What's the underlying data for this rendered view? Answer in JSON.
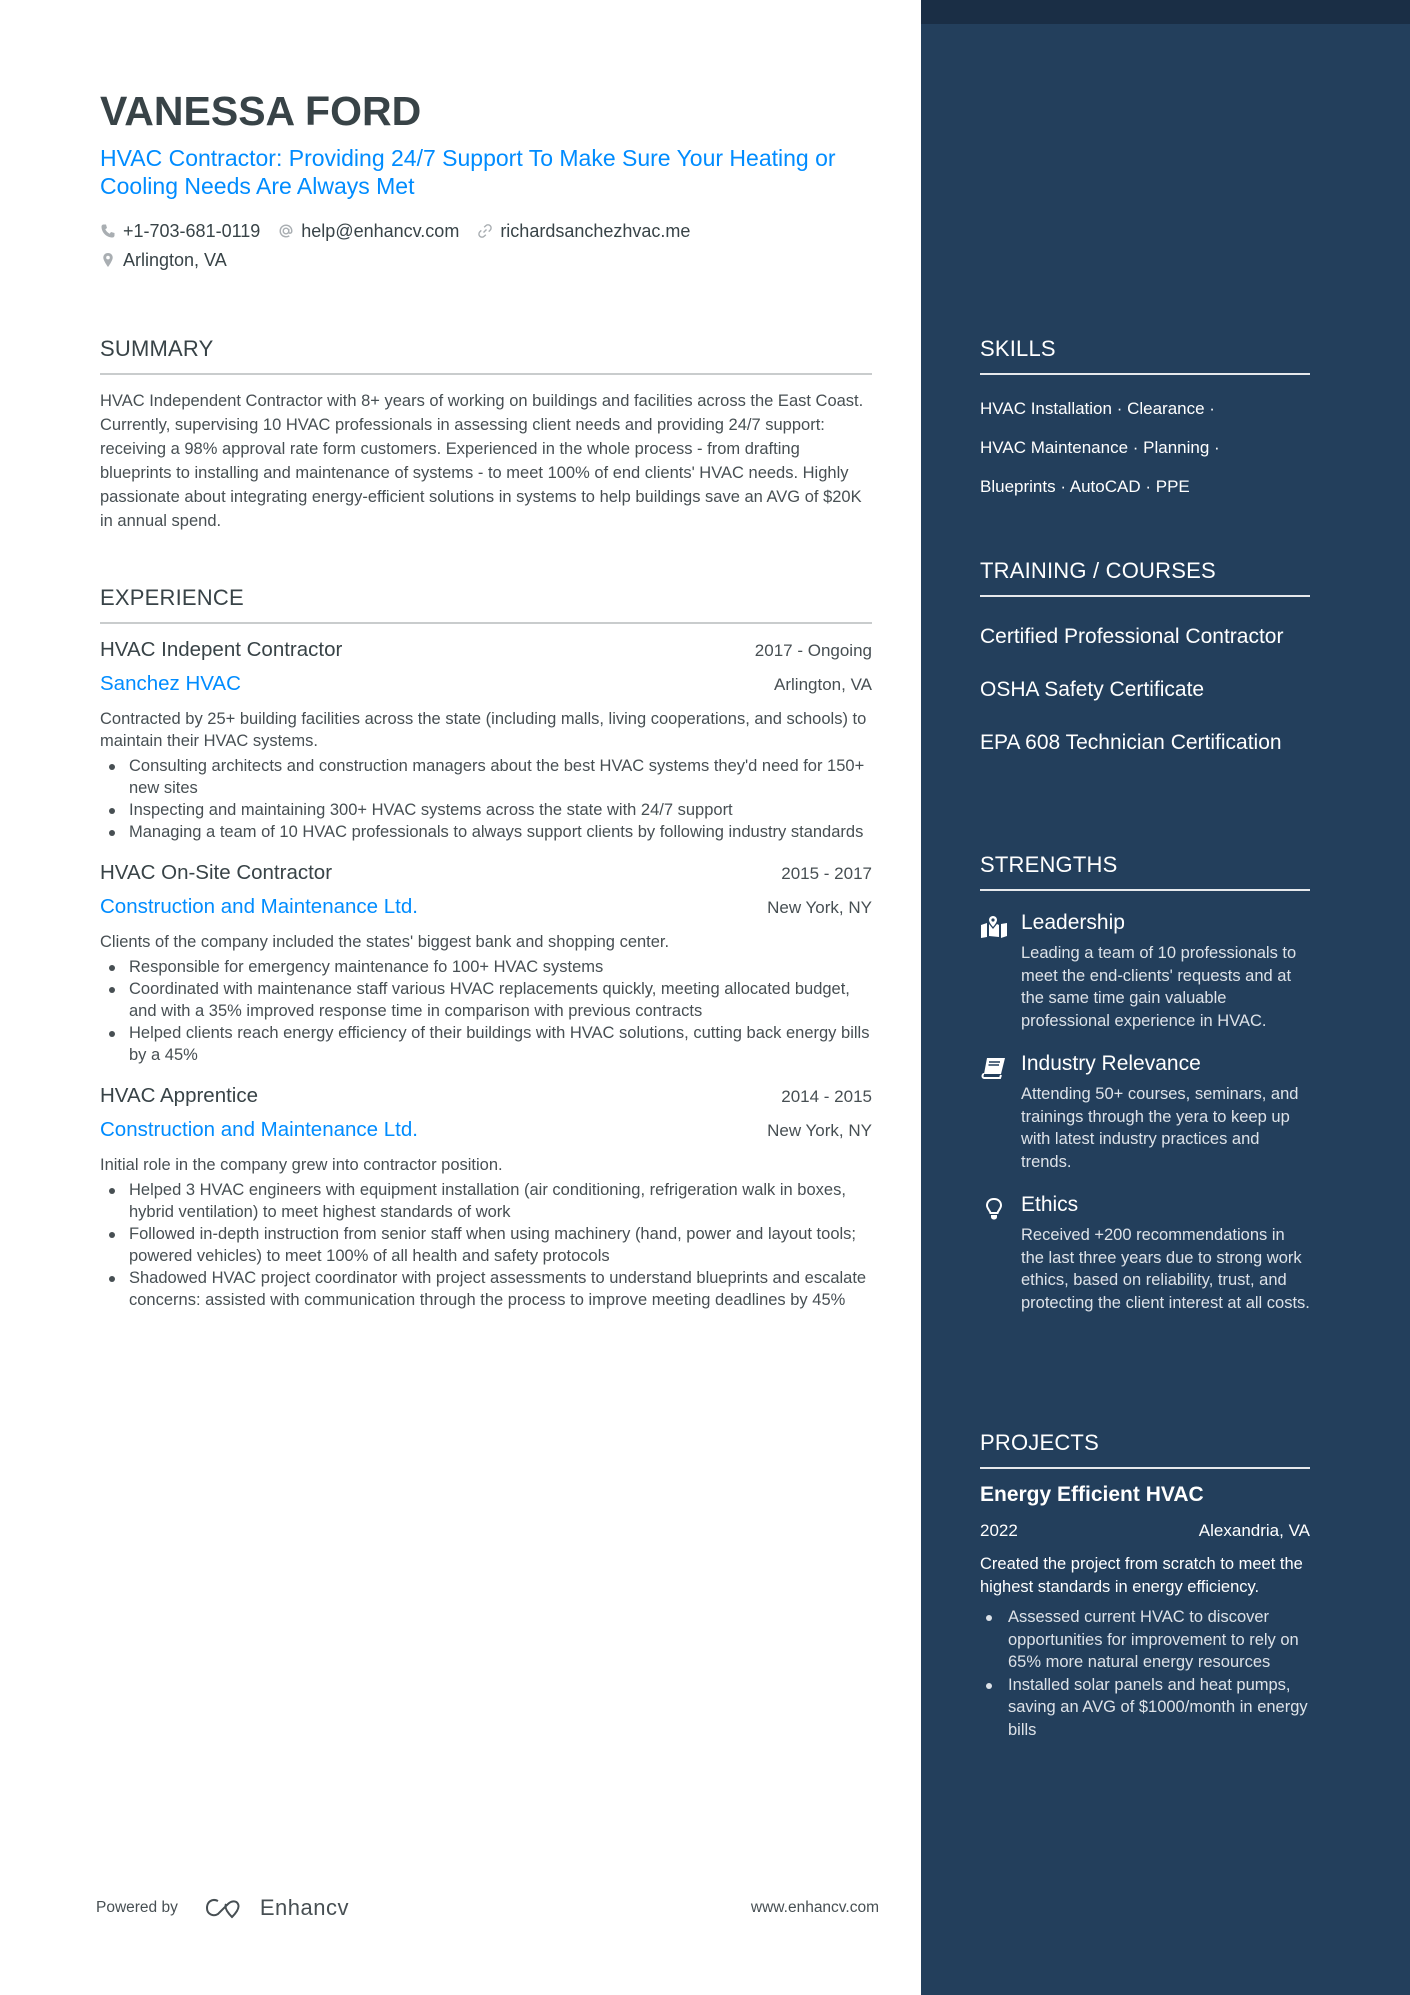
{
  "header": {
    "name": "VANESSA FORD",
    "headline": "HVAC Contractor: Providing 24/7 Support To Make Sure Your Heating or Cooling Needs Are Always Met",
    "contacts": {
      "phone": {
        "icon": "phone-icon",
        "value": "+1-703-681-0119"
      },
      "email": {
        "icon": "at-icon",
        "value": "help@enhancv.com"
      },
      "website": {
        "icon": "link-icon",
        "value": "richardsanchezhvac.me"
      },
      "location": {
        "icon": "location-pin-icon",
        "value": "Arlington,  VA"
      }
    }
  },
  "summary": {
    "title": "SUMMARY",
    "text": "HVAC Independent Contractor with 8+ years of working on buildings and facilities across the East Coast. Currently, supervising 10 HVAC professionals in assessing client needs and providing 24/7 support: receiving a 98% approval rate form customers. Experienced in the whole process - from drafting blueprints to installing and maintenance of systems - to meet 100% of end clients' HVAC needs. Highly passionate about integrating energy-efficient solutions in systems to help buildings save an AVG of $20K in annual spend."
  },
  "experience": {
    "title": "EXPERIENCE",
    "jobs": [
      {
        "title": "HVAC Indepent Contractor",
        "dates": "2017 - Ongoing",
        "company": "Sanchez HVAC",
        "location": "Arlington,  VA",
        "description": "Contracted by 25+ building facilities across the state (including malls, living cooperations, and schools) to maintain their HVAC systems.",
        "bullets": [
          "Consulting architects and construction managers about the best HVAC systems they'd need for 150+ new sites",
          "Inspecting and maintaining 300+ HVAC systems across the state with 24/7 support",
          "Managing a team of 10 HVAC professionals to always support clients by following industry standards"
        ]
      },
      {
        "title": "HVAC On-Site Contractor",
        "dates": "2015 - 2017",
        "company": "Construction and Maintenance Ltd.",
        "location": "New York, NY",
        "description": "Clients of the company included the states' biggest bank and shopping center.",
        "bullets": [
          "Responsible for emergency maintenance fo 100+ HVAC systems",
          "Coordinated with maintenance staff various HVAC replacements quickly, meeting allocated budget, and with a 35% improved response time in comparison with previous contracts",
          "Helped clients reach energy efficiency of their buildings with HVAC solutions, cutting back energy bills by a 45%"
        ]
      },
      {
        "title": "HVAC Apprentice",
        "dates": "2014 - 2015",
        "company": "Construction and Maintenance Ltd.",
        "location": "New York, NY",
        "description": "Initial role in the company grew into contractor position.",
        "bullets": [
          "Helped 3 HVAC engineers with equipment installation (air conditioning, refrigeration walk in boxes, hybrid ventilation) to meet highest standards of work",
          "Followed in-depth instruction from senior staff when using machinery (hand, power and layout tools; powered vehicles) to meet 100% of all health and safety protocols",
          "Shadowed HVAC project coordinator with project assessments to understand blueprints and escalate concerns: assisted with communication through the process to improve meeting deadlines by 45%"
        ]
      }
    ]
  },
  "skills": {
    "title": "SKILLS",
    "lines": [
      "HVAC Installation · Clearance ·",
      "HVAC Maintenance · Planning ·",
      "Blueprints · AutoCAD · PPE"
    ]
  },
  "training": {
    "title": "TRAINING / COURSES",
    "items": [
      "Certified Professional Contractor",
      "OSHA Safety Certificate",
      "EPA 608 Technician Certification"
    ]
  },
  "strengths": {
    "title": "STRENGTHS",
    "items": [
      {
        "icon": "map-pin-icon",
        "name": "Leadership",
        "description": "Leading a team of 10 professionals to meet the end-clients' requests and at the same time gain valuable professional experience in HVAC."
      },
      {
        "icon": "book-icon",
        "name": "Industry Relevance",
        "description": "Attending 50+ courses, seminars, and trainings through the yera to keep up with latest industry practices and trends."
      },
      {
        "icon": "lightbulb-icon",
        "name": "Ethics",
        "description": "Received +200 recommendations in the last three years due to strong work ethics, based on reliability, trust, and protecting the client interest at all costs."
      }
    ]
  },
  "projects": {
    "title": "PROJECTS",
    "items": [
      {
        "name": "Energy Efficient HVAC",
        "year": "2022",
        "location": "Alexandria, VA",
        "description": "Created the project from scratch to meet the highest standards in energy efficiency.",
        "bullets": [
          "Assessed current HVAC to discover opportunities for improvement to rely on 65% more natural energy resources",
          "Installed solar panels and heat pumps, saving an AVG of $1000/month in energy bills"
        ]
      }
    ]
  },
  "footer": {
    "powered_by": "Powered by",
    "brand": "Enhancv",
    "website": "www.enhancv.com"
  },
  "colors": {
    "accent": "#008cff",
    "sidebar_bg": "#233f5c",
    "sidebar_top": "#1a2e45",
    "text": "#384347"
  }
}
